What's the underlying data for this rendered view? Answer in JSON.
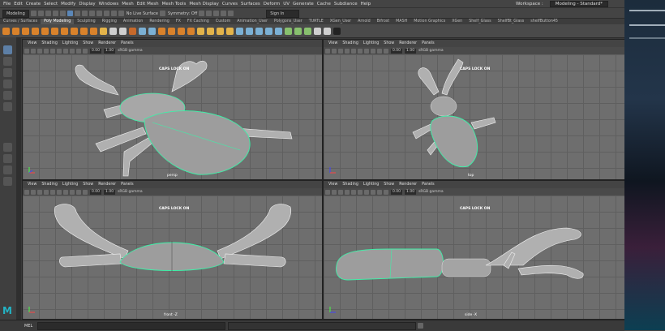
{
  "menubar": {
    "items": [
      "File",
      "Edit",
      "Create",
      "Select",
      "Modify",
      "Display",
      "Windows",
      "Mesh",
      "Edit Mesh",
      "Mesh Tools",
      "Mesh Display",
      "Curves",
      "Surfaces",
      "Deform",
      "UV",
      "Generate",
      "Cache",
      "Subdiance",
      "Help"
    ],
    "workspace_label": "Workspace :",
    "workspace_value": "Modeling - Standard*"
  },
  "statusline": {
    "mode": "Modeling",
    "live_surface": "No Live Surface",
    "symmetry": "Symmetry: Off",
    "sign_in": "Sign In"
  },
  "shelf_tabs": [
    {
      "label": "Curves / Surfaces",
      "active": false
    },
    {
      "label": "Poly Modeling",
      "active": true
    },
    {
      "label": "Sculpting",
      "active": false
    },
    {
      "label": "Rigging",
      "active": false
    },
    {
      "label": "Animation",
      "active": false
    },
    {
      "label": "Rendering",
      "active": false
    },
    {
      "label": "FX",
      "active": false
    },
    {
      "label": "FX Caching",
      "active": false
    },
    {
      "label": "Custom",
      "active": false
    },
    {
      "label": "Animation_User",
      "active": false
    },
    {
      "label": "Polygons_User",
      "active": false
    },
    {
      "label": "TURTLE",
      "active": false
    },
    {
      "label": "XGen_User",
      "active": false
    },
    {
      "label": "Arnold",
      "active": false
    },
    {
      "label": "Bifrost",
      "active": false
    },
    {
      "label": "MASH",
      "active": false
    },
    {
      "label": "Motion Graphics",
      "active": false
    },
    {
      "label": "XGen",
      "active": false
    },
    {
      "label": "Shelf_Glass",
      "active": false
    },
    {
      "label": "ShelfBt_Glass",
      "active": false
    },
    {
      "label": "shelfButton45",
      "active": false
    }
  ],
  "panel_menu": [
    "View",
    "Shading",
    "Lighting",
    "Show",
    "Renderer",
    "Panels"
  ],
  "viewports": [
    {
      "camera": "persp",
      "caps": "CAPS LOCK ON",
      "val1": "0.00",
      "val2": "1.00",
      "colorspace": "sRGB gamma"
    },
    {
      "camera": "top",
      "caps": "CAPS LOCK ON",
      "val1": "0.00",
      "val2": "1.00",
      "colorspace": "sRGB gamma"
    },
    {
      "camera": "front -Z",
      "caps": "CAPS LOCK ON",
      "val1": "0.00",
      "val2": "1.00",
      "colorspace": "sRGB gamma"
    },
    {
      "camera": "side -X",
      "caps": "CAPS LOCK ON",
      "val1": "0.00",
      "val2": "1.00",
      "colorspace": "sRGB gamma"
    }
  ],
  "commandline": {
    "label": "MEL"
  },
  "colors": {
    "accent": "#5d7fa6",
    "viewport_bg": "#6d6d6d",
    "mesh_wire": "#f2f2f2",
    "selection": "#3ef0a8",
    "maya_logo": "#23b3c4"
  }
}
